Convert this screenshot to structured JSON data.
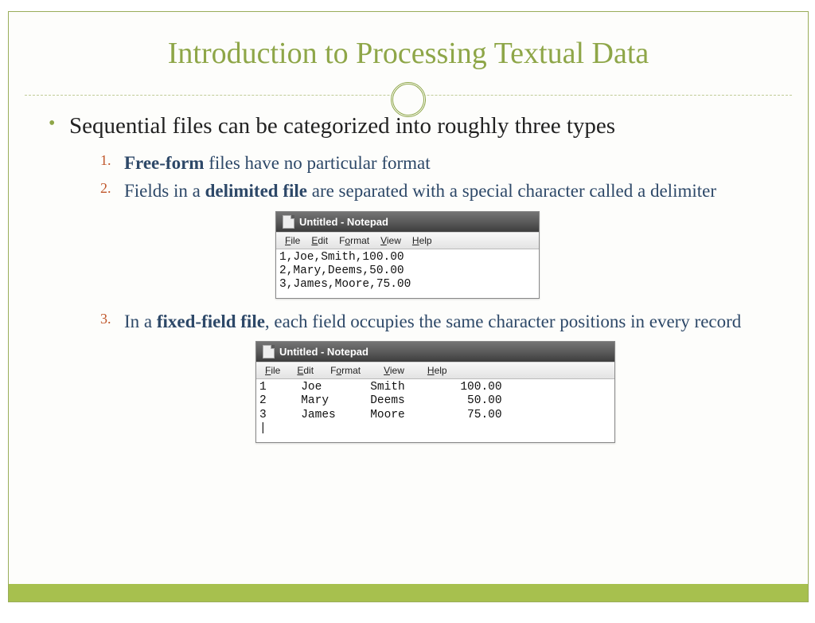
{
  "title": "Introduction to Processing Textual Data",
  "mainBullet": "Sequential files can be categorized into roughly three types",
  "items": {
    "n1": "1.",
    "t1a": "Free-form",
    "t1b": " files have no particular format",
    "n2": "2.",
    "t2a": "Fields in a ",
    "t2b": "delimited file",
    "t2c": " are separated with a special character called a delimiter",
    "n3": "3.",
    "t3a": "In a ",
    "t3b": "fixed-field file",
    "t3c": ", each field occupies the same character positions in every record"
  },
  "notepad": {
    "title": "Untitled - Notepad",
    "menu": {
      "file": "File",
      "edit": "Edit",
      "format": "Format",
      "view": "View",
      "help": "Help"
    },
    "body1": "1,Joe,Smith,100.00\n2,Mary,Deems,50.00\n3,James,Moore,75.00",
    "body2": "1     Joe       Smith        100.00\n2     Mary      Deems         50.00\n3     James     Moore         75.00\n|"
  }
}
